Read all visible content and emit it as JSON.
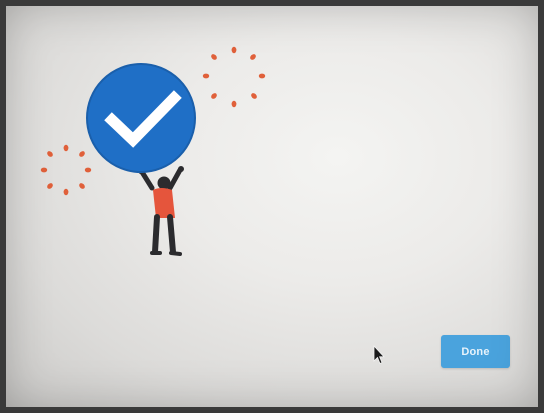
{
  "dialog": {
    "done_label": "Done"
  },
  "colors": {
    "accent": "#4aa3dd",
    "badge_blue": "#1f6fc6",
    "figure_shirt": "#e5553c",
    "sparkle": "#e0603a"
  },
  "icons": {
    "badge": "checkmark-badge-icon",
    "cursor": "mouse-pointer-icon"
  }
}
